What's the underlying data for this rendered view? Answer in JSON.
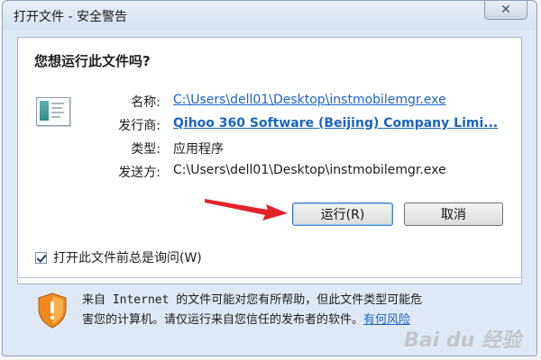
{
  "dialog": {
    "title": "打开文件 - 安全警告",
    "close_glyph": "✕",
    "question": "您想运行此文件吗?",
    "fields": [
      {
        "label": "名称:",
        "value": "C:\\Users\\dell01\\Desktop\\instmobilemgr.exe"
      },
      {
        "label": "发行商:",
        "value": "Qihoo 360 Software (Beijing) Company Limi..."
      },
      {
        "label": "类型:",
        "value": "应用程序"
      },
      {
        "label": "发送方:",
        "value": "C:\\Users\\dell01\\Desktop\\instmobilemgr.exe"
      }
    ],
    "buttons": {
      "run": "运行(R)",
      "cancel": "取消"
    },
    "checkbox": {
      "label": "打开此文件前总是询问(W)",
      "checked": true
    },
    "warning": {
      "line1": "来自 Internet 的文件可能对您有所帮助，但此文件类型可能危",
      "line2_text": "害您的计算机。请仅运行来自您信任的发布者的软件。",
      "link": "有何风险"
    }
  },
  "background": {
    "glyphs": [
      "r",
      "k",
      "e",
      "全"
    ]
  },
  "watermark": "Bai du 经验",
  "colors": {
    "link": "#1b63c6",
    "arrow": "#e2222a",
    "shield_orange": "#f08a1c"
  },
  "icons": {
    "file_icon": "application-window-icon",
    "shield_icon": "security-shield-icon",
    "arrow": "red-arrow-annotation"
  }
}
